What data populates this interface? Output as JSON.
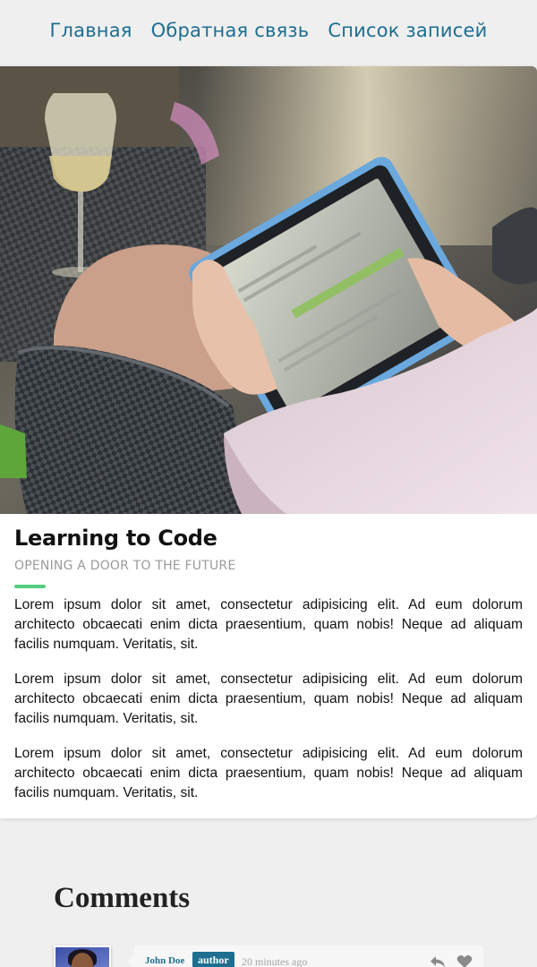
{
  "nav": {
    "items": [
      {
        "label": "Главная"
      },
      {
        "label": "Обратная связь"
      },
      {
        "label": "Список записей"
      }
    ]
  },
  "post": {
    "title": "Learning to Code",
    "subtitle": "OPENING A DOOR TO THE FUTURE",
    "accent_color": "#53cf7d",
    "paragraphs": [
      "Lorem ipsum dolor sit amet, consectetur adipisicing elit. Ad eum dolorum architecto obcaecati enim dicta praesentium, quam nobis! Neque ad aliquam facilis numquam. Veritatis, sit.",
      "Lorem ipsum dolor sit amet, consectetur adipisicing elit. Ad eum dolorum architecto obcaecati enim dicta praesentium, quam nobis! Neque ad aliquam facilis numquam. Veritatis, sit.",
      "Lorem ipsum dolor sit amet, consectetur adipisicing elit. Ad eum dolorum architecto obcaecati enim dicta praesentium, quam nobis! Neque ad aliquam facilis numquam. Veritatis, sit."
    ]
  },
  "comments": {
    "title": "Comments",
    "items": [
      {
        "author": "John Doe",
        "badge": "author",
        "time": "20 minutes ago"
      }
    ]
  },
  "colors": {
    "link": "#1d6e8f",
    "accent": "#53cf7d",
    "background": "#efefef"
  },
  "icons": {
    "reply": "reply-icon",
    "like": "heart-icon"
  }
}
